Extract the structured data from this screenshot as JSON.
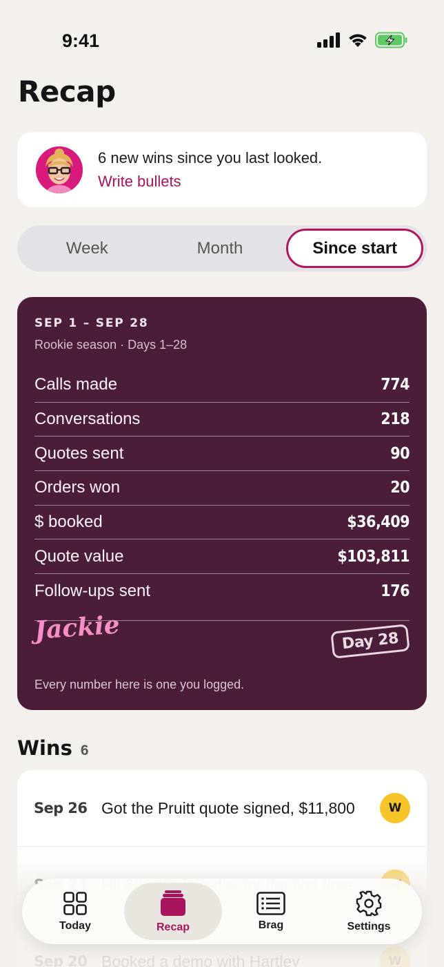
{
  "status_bar": {
    "time": "9:41"
  },
  "page": {
    "title": "Recap"
  },
  "nudge": {
    "message": "6 new wins since you last looked.",
    "link": "Write bullets"
  },
  "segments": [
    {
      "label": "Week",
      "active": false
    },
    {
      "label": "Month",
      "active": false
    },
    {
      "label": "Since start",
      "active": true
    }
  ],
  "recap": {
    "range": "SEP 1 – SEP 28",
    "subtitle": "Rookie season · Days 1–28",
    "stats": [
      {
        "label": "Calls made",
        "value": "774"
      },
      {
        "label": "Conversations",
        "value": "218"
      },
      {
        "label": "Quotes sent",
        "value": "90"
      },
      {
        "label": "Orders won",
        "value": "20"
      },
      {
        "label": "$ booked",
        "value": "$36,409"
      },
      {
        "label": "Quote value",
        "value": "$103,811"
      },
      {
        "label": "Follow-ups sent",
        "value": "176"
      }
    ],
    "signature": "Jackie",
    "day_stamp": "Day 28",
    "footnote": "Every number here is one you logged."
  },
  "wins": {
    "title": "Wins",
    "count": "6",
    "items": [
      {
        "date": "Sep 26",
        "text": "Got the Pruitt quote signed, $11,800",
        "badge": "W"
      },
      {
        "date": "Sep 24",
        "text": "Hit 60 calls in a day for the first time",
        "badge": "W"
      },
      {
        "date": "Sep 20",
        "text": "Booked a demo with Hartley",
        "badge": "W"
      }
    ]
  },
  "tabs": [
    {
      "label": "Today",
      "icon": "grid-icon"
    },
    {
      "label": "Recap",
      "icon": "stack-icon",
      "active": true
    },
    {
      "label": "Brag",
      "icon": "list-doc-icon"
    },
    {
      "label": "Settings",
      "icon": "gear-icon"
    }
  ],
  "colors": {
    "background": "#f4f0eb",
    "accent": "#a8145c",
    "recap_card": "#4b1d39",
    "win_badge": "#f6c52b",
    "signature": "#f58fc4"
  }
}
